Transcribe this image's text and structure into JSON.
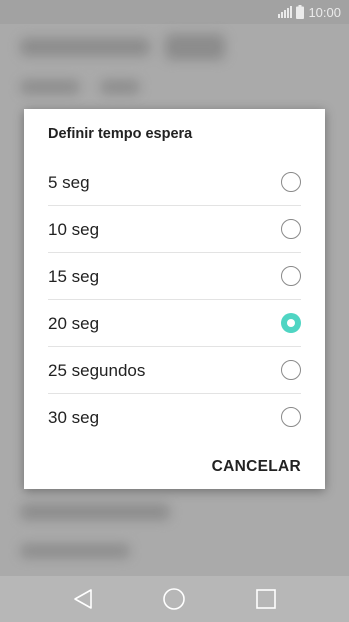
{
  "status_bar": {
    "time": "10:00",
    "signal_icon": "signal-icon",
    "battery_icon": "battery-icon"
  },
  "dialog": {
    "title": "Definir tempo espera",
    "options": [
      {
        "label": "5 seg",
        "selected": false
      },
      {
        "label": "10 seg",
        "selected": false
      },
      {
        "label": "15 seg",
        "selected": false
      },
      {
        "label": "20 seg",
        "selected": true
      },
      {
        "label": "25 segundos",
        "selected": false
      },
      {
        "label": "30 seg",
        "selected": false
      }
    ],
    "cancel_label": "CANCELAR"
  },
  "nav_bar": {
    "back_icon": "back-triangle-icon",
    "home_icon": "home-circle-icon",
    "recents_icon": "recents-square-icon"
  },
  "colors": {
    "accent": "#4fd5c3",
    "background": "#b9b9b9",
    "dialog": "#ffffff",
    "text": "#222222"
  }
}
